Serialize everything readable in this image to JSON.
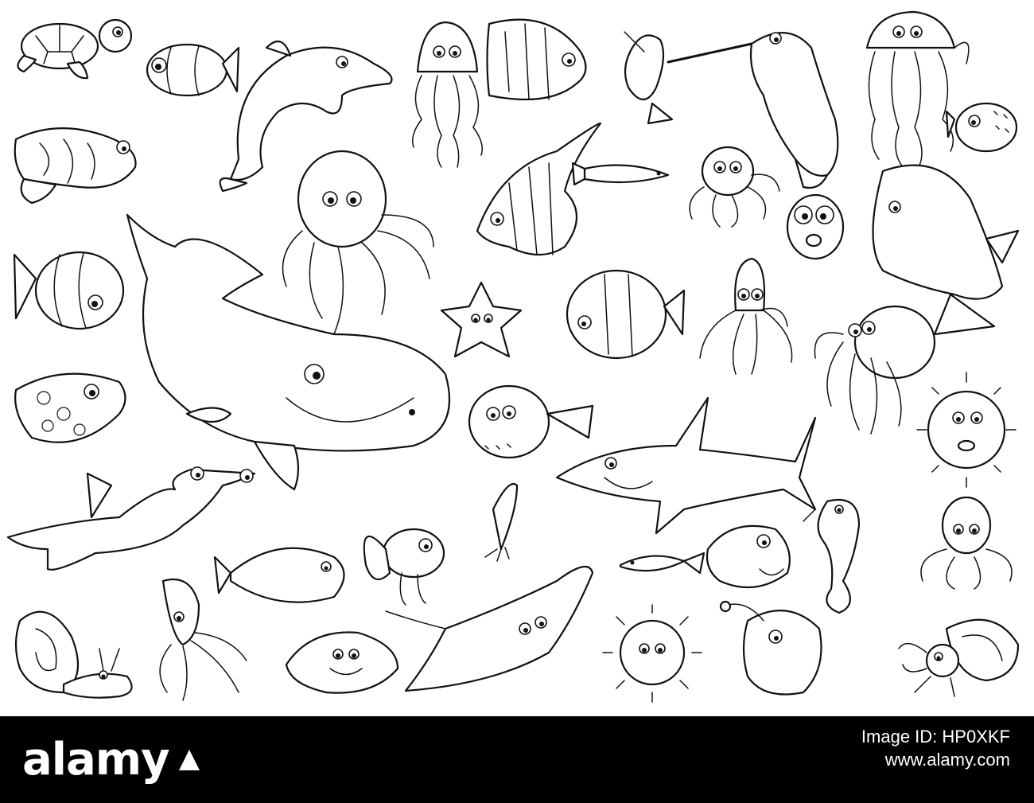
{
  "artwork": {
    "background_color": "#ffffff",
    "line_color": "#111111",
    "subjects": [
      "sea turtle",
      "clownfish",
      "dolphin",
      "jellyfish",
      "butterflyfish",
      "swordfish",
      "narwhal",
      "mandarin fish",
      "angelfish",
      "octopus",
      "sperm whale",
      "starfish",
      "squid",
      "pufferfish",
      "shark",
      "hammerhead shark",
      "seahorse",
      "tang fish",
      "piranha",
      "stingray",
      "sea urchin",
      "anglerfish",
      "snail",
      "clam",
      "hermit crab",
      "sardine"
    ]
  },
  "footer": {
    "background_color": "#000000",
    "brand": "alamy",
    "image_id_label": "Image ID: HP0XKF",
    "site_url": "www.alamy.com"
  }
}
